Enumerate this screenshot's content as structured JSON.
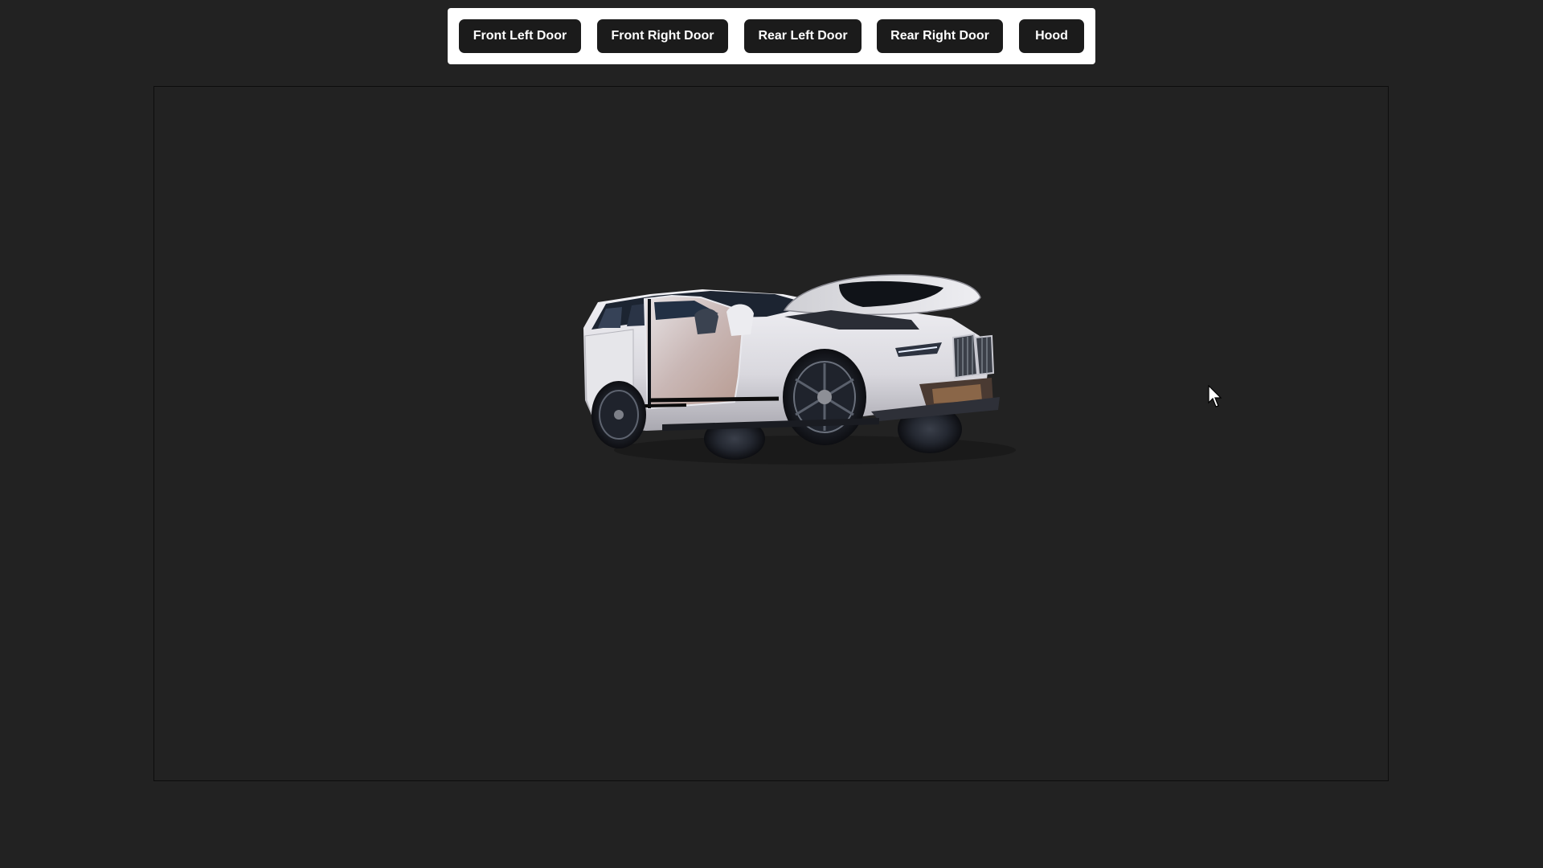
{
  "toolbar": {
    "buttons": [
      {
        "label": "Front Left Door"
      },
      {
        "label": "Front Right Door"
      },
      {
        "label": "Rear Left Door"
      },
      {
        "label": "Rear Right Door"
      },
      {
        "label": "Hood"
      }
    ]
  },
  "viewer": {
    "model": "white SUV with doors and hood open",
    "background_color": "#222222"
  },
  "colors": {
    "page_background": "#222222",
    "toolbar_background": "#ffffff",
    "button_background": "#1b1b1b",
    "button_text": "#ffffff"
  }
}
